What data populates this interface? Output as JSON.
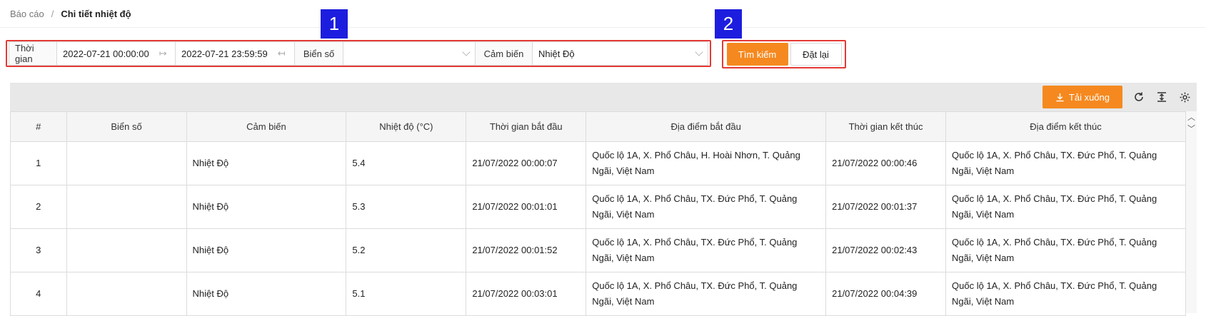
{
  "breadcrumb": {
    "parent": "Báo cáo",
    "separator": "/",
    "current": "Chi tiết nhiệt độ"
  },
  "annotations": [
    "1",
    "2"
  ],
  "filter": {
    "time_label": "Thời gian",
    "start_time": "2022-07-21 00:00:00",
    "end_time": "2022-07-21 23:59:59",
    "plate_label": "Biển số",
    "plate_value": "",
    "sensor_label": "Cảm biến",
    "sensor_value": "Nhiệt Độ"
  },
  "buttons": {
    "search": "Tìm kiếm",
    "reset": "Đặt lại",
    "download": "Tải xuống"
  },
  "table": {
    "columns": [
      "#",
      "Biển số",
      "Cảm biến",
      "Nhiệt độ (°C)",
      "Thời gian bắt đầu",
      "Địa điểm bắt đầu",
      "Thời gian kết thúc",
      "Địa điểm kết thúc"
    ],
    "rows": [
      [
        "1",
        "",
        "Nhiệt Độ",
        "5.4",
        "21/07/2022 00:00:07",
        "Quốc lộ 1A, X. Phổ Châu, H. Hoài Nhơn, T. Quảng Ngãi, Việt Nam",
        "21/07/2022 00:00:46",
        "Quốc lộ 1A, X. Phổ Châu, TX. Đức Phổ, T. Quảng Ngãi, Việt Nam"
      ],
      [
        "2",
        "",
        "Nhiệt Độ",
        "5.3",
        "21/07/2022 00:01:01",
        "Quốc lộ 1A, X. Phổ Châu, TX. Đức Phổ, T. Quảng Ngãi, Việt Nam",
        "21/07/2022 00:01:37",
        "Quốc lộ 1A, X. Phổ Châu, TX. Đức Phổ, T. Quảng Ngãi, Việt Nam"
      ],
      [
        "3",
        "",
        "Nhiệt Độ",
        "5.2",
        "21/07/2022 00:01:52",
        "Quốc lộ 1A, X. Phổ Châu, TX. Đức Phổ, T. Quảng Ngãi, Việt Nam",
        "21/07/2022 00:02:43",
        "Quốc lộ 1A, X. Phổ Châu, TX. Đức Phổ, T. Quảng Ngãi, Việt Nam"
      ],
      [
        "4",
        "",
        "Nhiệt Độ",
        "5.1",
        "21/07/2022 00:03:01",
        "Quốc lộ 1A, X. Phổ Châu, TX. Đức Phổ, T. Quảng Ngãi, Việt Nam",
        "21/07/2022 00:04:39",
        "Quốc lộ 1A, X. Phổ Châu, TX. Đức Phổ, T. Quảng Ngãi, Việt Nam"
      ]
    ]
  },
  "colors": {
    "accent": "#f5891f",
    "highlight": "#e53935",
    "badge": "#1d1ddf"
  },
  "icons": [
    "arrow-right-to-bar-icon",
    "arrow-left-to-bar-icon",
    "chevron-down-icon",
    "download-icon",
    "reload-icon",
    "column-height-icon",
    "settings-icon",
    "chevron-up-icon"
  ]
}
